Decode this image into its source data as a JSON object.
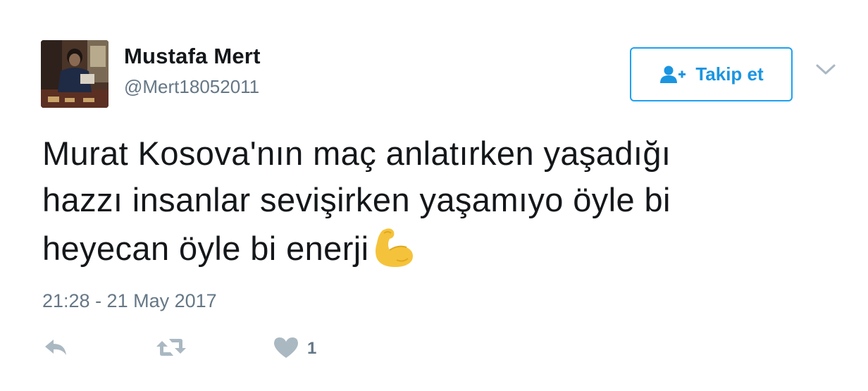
{
  "user": {
    "display_name": "Mustafa Mert",
    "handle": "@Mert18052011"
  },
  "follow_button": {
    "label": "Takip et",
    "icon": "add-user-icon"
  },
  "menu": {
    "icon": "chevron-down-icon"
  },
  "tweet": {
    "lines": [
      "Murat Kosova'nın maç anlatırken yaşadığı",
      "hazzı insanlar sevişirken yaşamıyo öyle bi",
      "heyecan öyle bi enerji"
    ],
    "emoji": "flexed-biceps-emoji",
    "timestamp": "21:28 - 21 May 2017"
  },
  "actions": {
    "reply_icon": "reply-icon",
    "retweet_icon": "retweet-icon",
    "like_icon": "heart-icon",
    "like_count": "1"
  },
  "colors": {
    "accent": "#1da1f2",
    "accent_text": "#1b95e0",
    "muted": "#657786",
    "muted_icon": "#aab8c2",
    "text": "#14171a",
    "emoji": "#f5c33b"
  }
}
